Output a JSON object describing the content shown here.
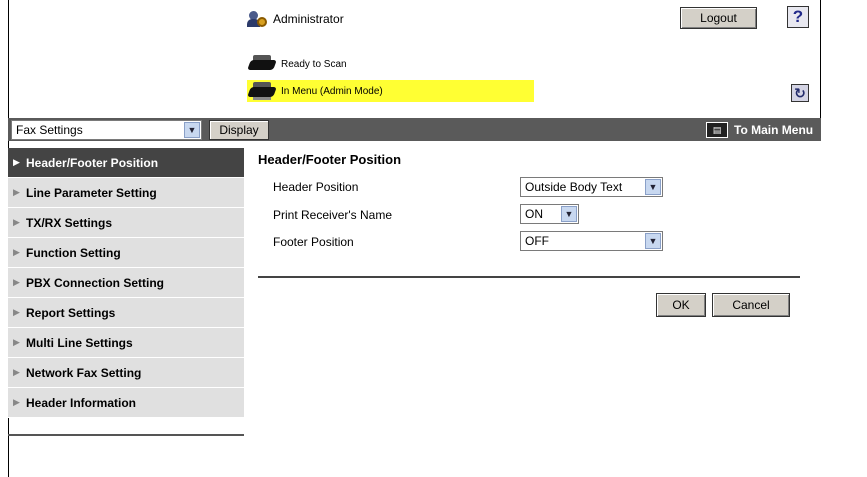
{
  "header": {
    "user_label": "Administrator",
    "logout_label": "Logout",
    "help_label": "?",
    "status_scan": "Ready to Scan",
    "status_menu": "In Menu (Admin Mode)",
    "refresh_icon": "refresh-icon",
    "accent_yellow": "#ffff33"
  },
  "toolbar": {
    "category_value": "Fax Settings",
    "display_label": "Display",
    "main_menu_label": "To Main Menu"
  },
  "sidebar": {
    "items": [
      {
        "label": "Header/Footer Position"
      },
      {
        "label": "Line Parameter Setting"
      },
      {
        "label": "TX/RX Settings"
      },
      {
        "label": "Function Setting"
      },
      {
        "label": "PBX Connection Setting"
      },
      {
        "label": "Report Settings"
      },
      {
        "label": "Multi Line Settings"
      },
      {
        "label": "Network Fax Setting"
      },
      {
        "label": "Header Information"
      }
    ]
  },
  "main": {
    "title": "Header/Footer Position",
    "fields": [
      {
        "label": "Header Position",
        "value": "Outside Body Text"
      },
      {
        "label": "Print Receiver's Name",
        "value": "ON"
      },
      {
        "label": "Footer Position",
        "value": "OFF"
      }
    ],
    "ok_label": "OK",
    "cancel_label": "Cancel"
  }
}
